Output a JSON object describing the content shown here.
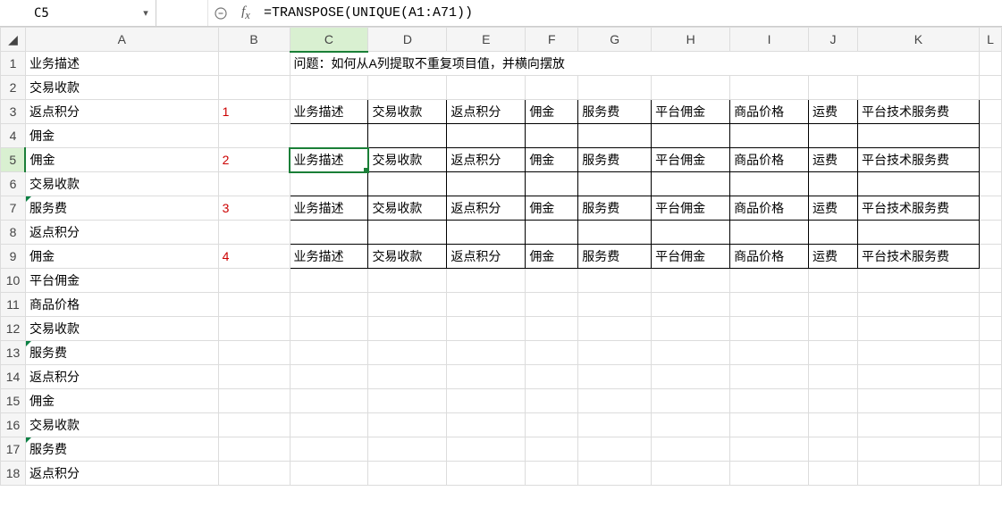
{
  "formula_bar": {
    "cell_ref": "C5",
    "formula": "=TRANSPOSE(UNIQUE(A1:A71))"
  },
  "columns": [
    "A",
    "B",
    "C",
    "D",
    "E",
    "F",
    "G",
    "H",
    "I",
    "J",
    "K",
    "L"
  ],
  "rows": [
    1,
    2,
    3,
    4,
    5,
    6,
    7,
    8,
    9,
    10,
    11,
    12,
    13,
    14,
    15,
    16,
    17,
    18
  ],
  "colA": {
    "1": "业务描述",
    "2": "交易收款",
    "3": "返点积分",
    "4": "佣金",
    "5": "佣金",
    "6": "交易收款",
    "7": "服务费",
    "8": "返点积分",
    "9": "佣金",
    "10": "平台佣金",
    "11": "商品价格",
    "12": "交易收款",
    "13": "服务费",
    "14": "返点积分",
    "15": "佣金",
    "16": "交易收款",
    "17": "服务费",
    "18": "返点积分"
  },
  "question": "问题：如何从A列提取不重复项目值，并横向摆放",
  "rownums": {
    "r3": "1",
    "r5": "2",
    "r7": "3",
    "r9": "4"
  },
  "unique_row": {
    "C": "业务描述",
    "D": "交易收款",
    "E": "返点积分",
    "F": "佣金",
    "G": "服务费",
    "H": "平台佣金",
    "I": "商品价格",
    "J": "运费",
    "K": "平台技术服务费"
  },
  "selected": {
    "col": "C",
    "row": 5
  }
}
